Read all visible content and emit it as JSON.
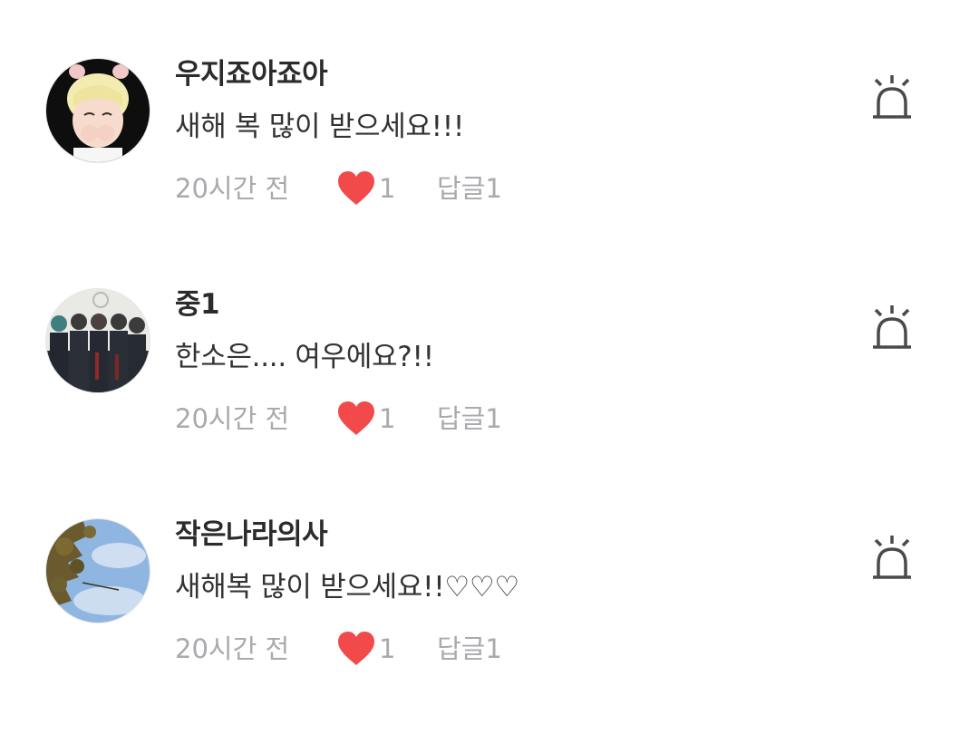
{
  "comments": [
    {
      "username": "우지죠아죠아",
      "text": "새해 복 많이 받으세요!!!",
      "time": "20시간 전",
      "likes": "1",
      "reply": "답글1",
      "avatar": "bleached-hair-person-avatar"
    },
    {
      "username": "중1",
      "text": "한소은.... 여우에요?!!",
      "time": "20시간 전",
      "likes": "1",
      "reply": "답글1",
      "avatar": "group-photo-avatar"
    },
    {
      "username": "작은나라의사",
      "text": "새해복 많이 받으세요!!♡♡♡",
      "time": "20시간 전",
      "likes": "1",
      "reply": "답글1",
      "avatar": "sky-tree-avatar"
    }
  ],
  "colors": {
    "heart": "#f24a4a",
    "meta_text": "#a9a9ae",
    "username": "#2b2b2b",
    "icon": "#4a4a4a"
  }
}
